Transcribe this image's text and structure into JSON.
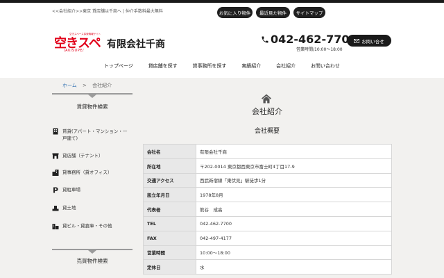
{
  "header": {
    "tagline": "<<会社紹介>>東京 貸店舗は千商へ | 仲介手数料最大無料",
    "top_buttons": [
      "お気に入り物件",
      "最近見た物件",
      "サイトマップ"
    ],
    "logo_text": "空きスペ",
    "logo_sub": "空きスペース探索情報サイト",
    "logo_roman": "/AKISUPE/",
    "company_name": "有限会社千商",
    "phone": "042-462-7700",
    "hours": "営業時間/10:00〜18:00",
    "contact_label": "お問い合せ"
  },
  "nav": [
    "トップページ",
    "貸店舗を探す",
    "貸事務所を探す",
    "実績紹介",
    "会社紹介",
    "お問い合わせ"
  ],
  "breadcrumb": {
    "home": "ホーム",
    "sep": ">",
    "current": "会社紹介"
  },
  "sidebar": {
    "rent_title": "賃貸物件検索",
    "rent_items": [
      "賃貸(アパート・マンション・一戸建て)",
      "貸店舗（テナント）",
      "貸事務所（貸オフィス）",
      "貸駐車場",
      "貸土地",
      "貸ビル・貸倉庫・その他"
    ],
    "sale_title": "売買物件検索"
  },
  "main": {
    "page_title": "会社紹介",
    "section_title": "会社概要",
    "rows": [
      {
        "label": "会社名",
        "value": "有限会社千商"
      },
      {
        "label": "所在地",
        "value": "〒202-0014 東京都西東京市富士町4丁目17-9"
      },
      {
        "label": "交通アクセス",
        "value": "西武新宿線「東伏見」駅徒歩1分"
      },
      {
        "label": "設立年月日",
        "value": "1978年8月"
      },
      {
        "label": "代表者",
        "value": "熊谷　成高"
      },
      {
        "label": "TEL",
        "value": "042-462-7700"
      },
      {
        "label": "FAX",
        "value": "042-497-4177"
      },
      {
        "label": "営業時間",
        "value": "10:00〜18:00"
      },
      {
        "label": "定休日",
        "value": "水"
      }
    ]
  }
}
